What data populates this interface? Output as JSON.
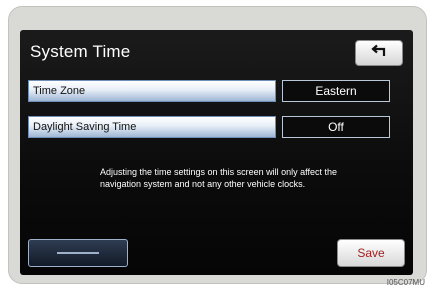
{
  "screen": {
    "title": "System Time",
    "back_icon": "back-arrow-icon"
  },
  "settings": [
    {
      "label": "Time Zone",
      "value": "Eastern"
    },
    {
      "label": "Daylight Saving Time",
      "value": "Off"
    }
  ],
  "note": "Adjusting the time settings on this screen will only affect the navigation system and not any other vehicle clocks.",
  "buttons": {
    "save": "Save",
    "map_icon": "map-icon"
  },
  "figure_code": "I05C07MU",
  "colors": {
    "screen_bg": "#0c0c0c",
    "row_highlight": "#9fb7d4",
    "save_text": "#a32020"
  }
}
